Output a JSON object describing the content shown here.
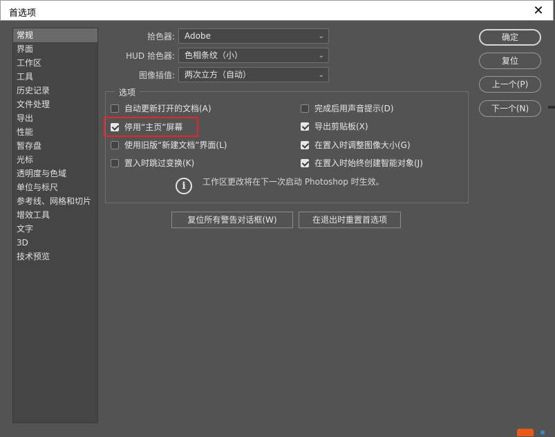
{
  "window": {
    "title": "首选项",
    "close_glyph": "✕"
  },
  "sidebar": {
    "items": [
      {
        "label": "常规",
        "active": true
      },
      {
        "label": "界面"
      },
      {
        "label": "工作区"
      },
      {
        "label": "工具"
      },
      {
        "label": "历史记录"
      },
      {
        "label": "文件处理"
      },
      {
        "label": "导出"
      },
      {
        "label": "性能"
      },
      {
        "label": "暂存盘"
      },
      {
        "label": "光标"
      },
      {
        "label": "透明度与色域"
      },
      {
        "label": "单位与标尺"
      },
      {
        "label": "参考线、网格和切片"
      },
      {
        "label": "增效工具"
      },
      {
        "label": "文字"
      },
      {
        "label": "3D"
      },
      {
        "label": "技术预览"
      }
    ]
  },
  "fields": {
    "color_picker": {
      "label": "拾色器:",
      "value": "Adobe"
    },
    "hud_color_picker": {
      "label": "HUD 拾色器:",
      "value": "色相条纹（小）"
    },
    "image_interpolation": {
      "label": "图像插值:",
      "value": "两次立方（自动）"
    }
  },
  "options": {
    "title": "选项",
    "auto_update_docs": {
      "label": "自动更新打开的文档(A)",
      "checked": false
    },
    "disable_home": {
      "label": "停用“主页”屏幕",
      "checked": true
    },
    "legacy_new_doc": {
      "label": "使用旧版“新建文档”界面(L)",
      "checked": false
    },
    "skip_transform": {
      "label": "置入时跳过变换(K)",
      "checked": false
    },
    "beep_when_done": {
      "label": "完成后用声音提示(D)",
      "checked": false
    },
    "export_clipboard": {
      "label": "导出剪贴板(X)",
      "checked": true
    },
    "resize_on_place": {
      "label": "在置入时调整图像大小(G)",
      "checked": true
    },
    "always_smart_objects": {
      "label": "在置入时始终创建智能对象(J)",
      "checked": true
    },
    "info_text": "工作区更改将在下一次启动 Photoshop 时生效。",
    "info_glyph": "i"
  },
  "buttons": {
    "reset_warnings": "复位所有警告对话框(W)",
    "reset_on_quit": "在退出时重置首选项",
    "ok": "确定",
    "reset": "复位",
    "prev": "上一个(P)",
    "next": "下一个(N)"
  },
  "colors": {
    "highlight": "#e2262b",
    "background": "#535353"
  }
}
